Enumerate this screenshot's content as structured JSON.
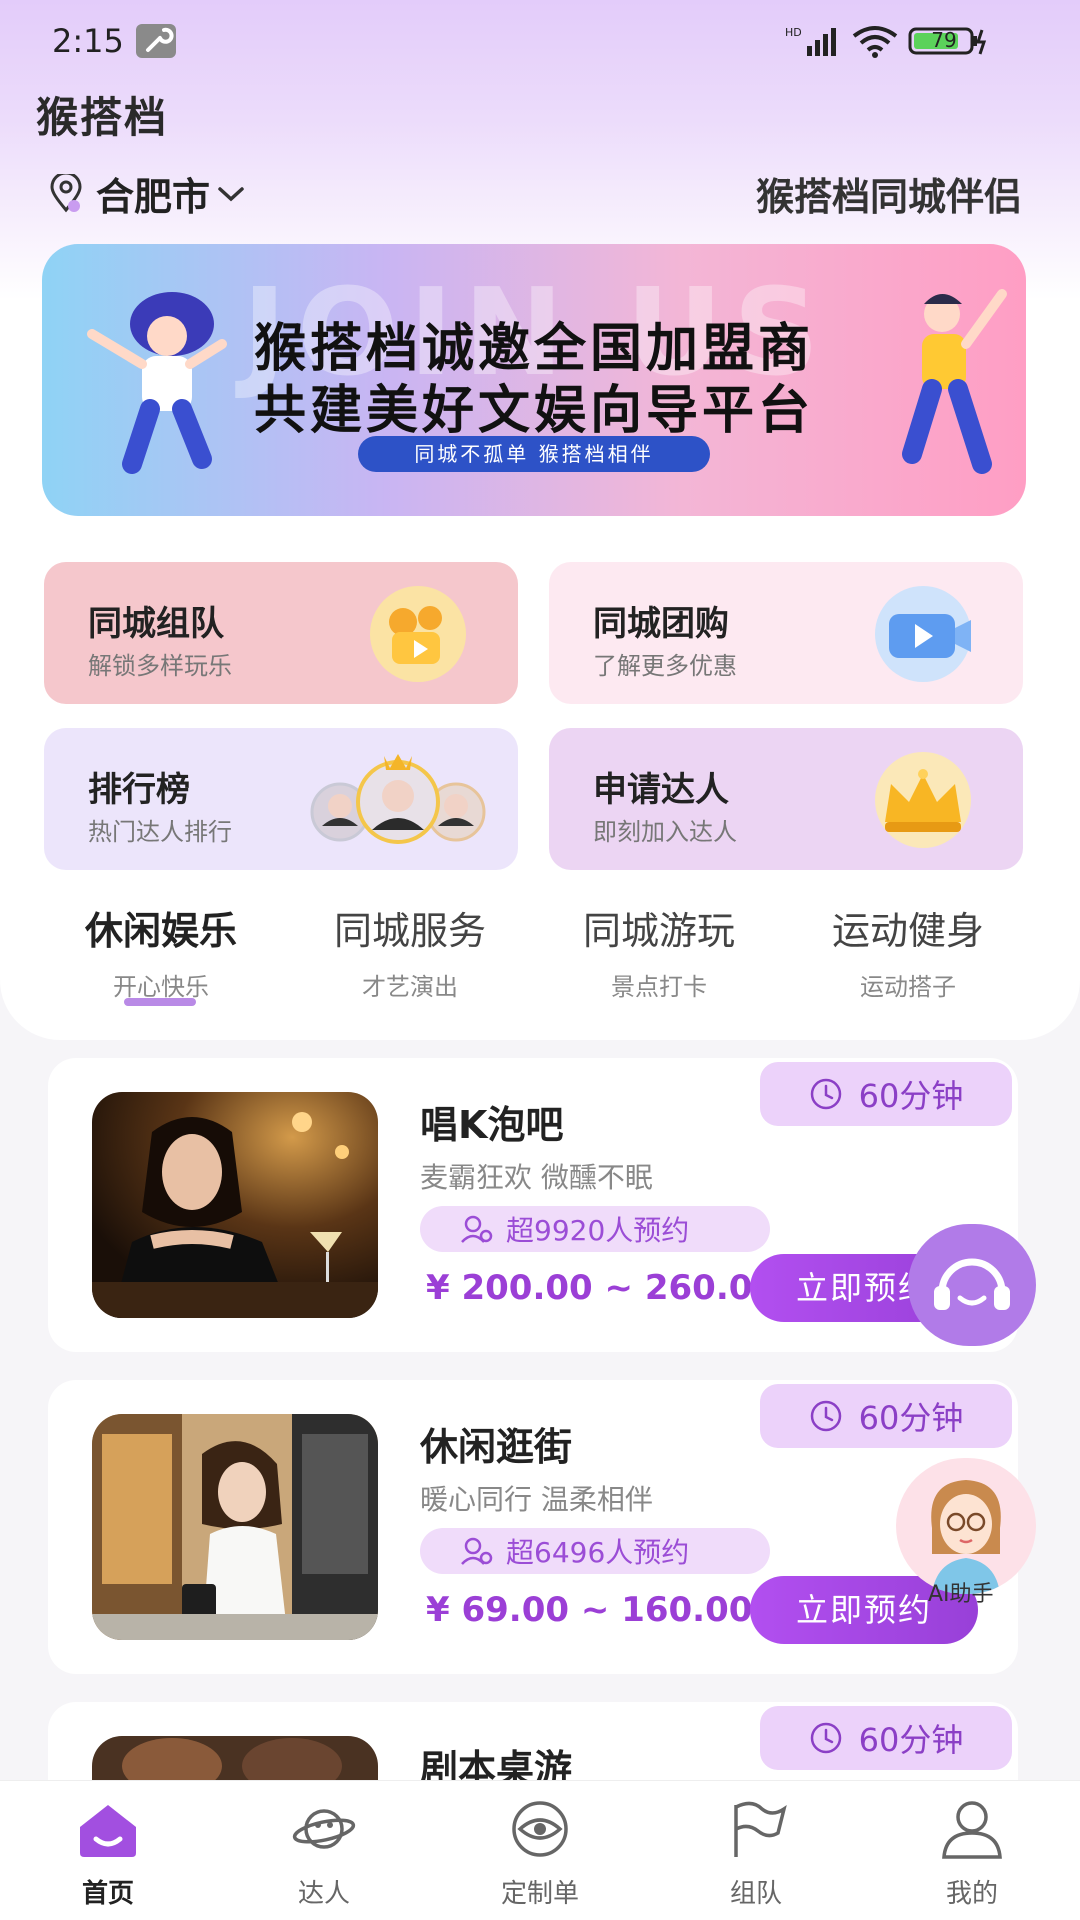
{
  "status_bar": {
    "time": "2:15",
    "battery": "79"
  },
  "header": {
    "app_title": "猴搭档",
    "city": "合肥市",
    "slogan": "猴搭档同城伴侣"
  },
  "banner": {
    "line1": "猴搭档诚邀全国加盟商",
    "line2": "共建美好文娱向导平台",
    "tagline": "同城不孤单  猴搭档相伴"
  },
  "features": [
    {
      "title": "同城组队",
      "subtitle": "解锁多样玩乐",
      "icon": "camera-icon"
    },
    {
      "title": "同城团购",
      "subtitle": "了解更多优惠",
      "icon": "video-icon"
    },
    {
      "title": "排行榜",
      "subtitle": "热门达人排行",
      "icon": "ranking-avatars"
    },
    {
      "title": "申请达人",
      "subtitle": "即刻加入达人",
      "icon": "crown-icon"
    }
  ],
  "categories": [
    {
      "title": "休闲娱乐",
      "subtitle": "开心快乐"
    },
    {
      "title": "同城服务",
      "subtitle": "才艺演出"
    },
    {
      "title": "同城游玩",
      "subtitle": "景点打卡"
    },
    {
      "title": "运动健身",
      "subtitle": "运动搭子"
    }
  ],
  "services": [
    {
      "name": "唱K泡吧",
      "desc": "麦霸狂欢 微醺不眠",
      "count": "超9920人预约",
      "price": "¥ 200.00 ~ 260.00",
      "duration": "60分钟",
      "book": "立即预约"
    },
    {
      "name": "休闲逛街",
      "desc": "暖心同行 温柔相伴",
      "count": "超6496人预约",
      "price": "¥ 69.00 ~ 160.00",
      "duration": "60分钟",
      "book": "立即预约"
    },
    {
      "name": "剧本桌游",
      "duration": "60分钟"
    }
  ],
  "floating": {
    "ai_label": "AI助手"
  },
  "nav": [
    {
      "label": "首页",
      "icon": "home-icon"
    },
    {
      "label": "达人",
      "icon": "planet-icon"
    },
    {
      "label": "定制单",
      "icon": "eye-icon"
    },
    {
      "label": "组队",
      "icon": "flag-icon"
    },
    {
      "label": "我的",
      "icon": "profile-icon"
    }
  ],
  "colors": {
    "accent": "#9b3fd6",
    "button": "#a848e4",
    "tab_underline": "#b98ae6"
  }
}
